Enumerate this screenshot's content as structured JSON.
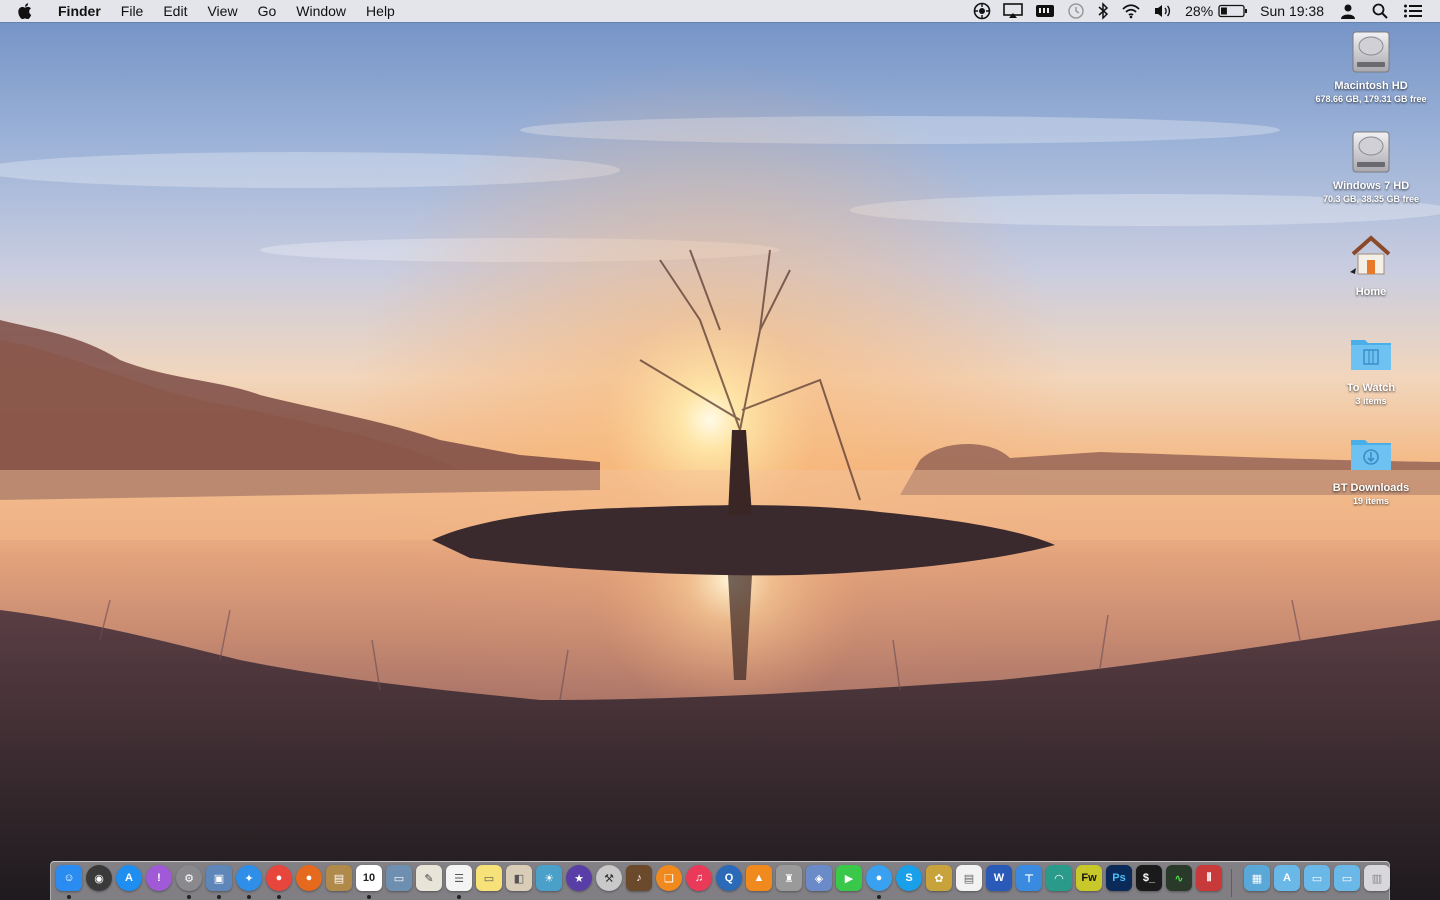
{
  "menubar": {
    "apple_icon": "apple-logo-icon",
    "app_name": "Finder",
    "menus": [
      "File",
      "Edit",
      "View",
      "Go",
      "Window",
      "Help"
    ],
    "status_icons": [
      "control-panel-icon",
      "airplay-icon",
      "screen-icon",
      "time-machine-icon",
      "bluetooth-icon",
      "wifi-icon",
      "volume-icon"
    ],
    "battery_percent": "28%",
    "battery_level": 0.28,
    "clock": "Sun 19:38",
    "user_icon": "user-icon",
    "search_icon": "spotlight-icon",
    "notifications_icon": "notification-center-icon"
  },
  "desktop": {
    "icons": [
      {
        "label": "Macintosh HD",
        "sub": "678.66 GB, 179.31 GB free",
        "icon": "hard-drive-icon"
      },
      {
        "label": "Windows 7 HD",
        "sub": "70.3 GB, 38.35 GB free",
        "icon": "hard-drive-icon"
      },
      {
        "label": "Home",
        "sub": "",
        "icon": "home-icon"
      },
      {
        "label": "To Watch",
        "sub": "3 items",
        "icon": "folder-icon"
      },
      {
        "label": "BT Downloads",
        "sub": "19 items",
        "icon": "folder-icon"
      }
    ]
  },
  "dock": {
    "items": [
      {
        "name": "finder",
        "glyph": "☺",
        "color": "#2a8cf0",
        "running": true
      },
      {
        "name": "dashboard",
        "glyph": "◉",
        "color": "#3a3a3a",
        "round": true,
        "running": false
      },
      {
        "name": "app-store",
        "glyph": "A",
        "color": "#1e8ff0",
        "round": true,
        "running": false
      },
      {
        "name": "itunes-alert",
        "glyph": "!",
        "color": "#a05ad8",
        "round": true,
        "running": false
      },
      {
        "name": "system-preferences",
        "glyph": "⚙",
        "color": "#8a8a8e",
        "round": true,
        "running": true
      },
      {
        "name": "preview",
        "glyph": "▣",
        "color": "#5f86b8",
        "running": true
      },
      {
        "name": "safari",
        "glyph": "✦",
        "color": "#2f8fe8",
        "round": true,
        "running": true
      },
      {
        "name": "chrome",
        "glyph": "●",
        "color": "#e8453c",
        "round": true,
        "running": true
      },
      {
        "name": "firefox",
        "glyph": "●",
        "color": "#e66a1e",
        "round": true,
        "running": false
      },
      {
        "name": "notefile",
        "glyph": "▤",
        "color": "#b08a4a",
        "running": false
      },
      {
        "name": "calendar",
        "glyph": "10",
        "color": "#ffffff",
        "textcolor": "#222",
        "running": true
      },
      {
        "name": "image-capture",
        "glyph": "▭",
        "color": "#6f8fb0",
        "running": false
      },
      {
        "name": "textedit",
        "glyph": "✎",
        "color": "#e8e4d8",
        "textcolor": "#444",
        "running": false
      },
      {
        "name": "reminders",
        "glyph": "☰",
        "color": "#f4f4f4",
        "textcolor": "#555",
        "running": true
      },
      {
        "name": "notes",
        "glyph": "▭",
        "color": "#f7e27a",
        "textcolor": "#555",
        "running": false
      },
      {
        "name": "contacts",
        "glyph": "◧",
        "color": "#d9cdb8",
        "textcolor": "#555",
        "running": false
      },
      {
        "name": "iphoto",
        "glyph": "☀",
        "color": "#4aa0c8",
        "running": false
      },
      {
        "name": "imovie",
        "glyph": "★",
        "color": "#5a3ea8",
        "round": true,
        "running": false
      },
      {
        "name": "disk-utility",
        "glyph": "⚒",
        "color": "#c9c9c9",
        "textcolor": "#333",
        "round": true,
        "running": false
      },
      {
        "name": "garageband",
        "glyph": "♪",
        "color": "#6a4a2a",
        "running": false
      },
      {
        "name": "ibooks",
        "glyph": "❑",
        "color": "#f08a1e",
        "round": true,
        "running": false
      },
      {
        "name": "itunes",
        "glyph": "♫",
        "color": "#ea3a5a",
        "round": true,
        "running": false
      },
      {
        "name": "quicktime",
        "glyph": "Q",
        "color": "#2a6ab8",
        "round": true,
        "running": false
      },
      {
        "name": "vlc",
        "glyph": "▲",
        "color": "#f08a1e",
        "running": false
      },
      {
        "name": "automator",
        "glyph": "♜",
        "color": "#9a9a9a",
        "running": false
      },
      {
        "name": "pacifist",
        "glyph": "◈",
        "color": "#6a8ac8",
        "running": false
      },
      {
        "name": "facetime",
        "glyph": "▶",
        "color": "#3ac84a",
        "running": false
      },
      {
        "name": "messages",
        "glyph": "●",
        "color": "#3aa0f0",
        "round": true,
        "running": true
      },
      {
        "name": "skype",
        "glyph": "S",
        "color": "#1aa0e8",
        "round": true,
        "running": false
      },
      {
        "name": "pineapple",
        "glyph": "✿",
        "color": "#c8a23a",
        "running": false
      },
      {
        "name": "text-doc",
        "glyph": "▤",
        "color": "#f2f2f2",
        "textcolor": "#666",
        "running": false
      },
      {
        "name": "word",
        "glyph": "W",
        "color": "#2a5ab8",
        "running": false
      },
      {
        "name": "keynote",
        "glyph": "⊤",
        "color": "#3a8ae0",
        "running": false
      },
      {
        "name": "wireless-diagnostics",
        "glyph": "◠",
        "color": "#2a9a8a",
        "running": false
      },
      {
        "name": "fireworks",
        "glyph": "Fw",
        "color": "#c8c82a",
        "textcolor": "#111",
        "running": false
      },
      {
        "name": "photoshop",
        "glyph": "Ps",
        "color": "#0a2a5a",
        "textcolor": "#4ac0f8",
        "running": false
      },
      {
        "name": "terminal",
        "glyph": "$_",
        "color": "#1a1a1a",
        "running": false
      },
      {
        "name": "activity-monitor",
        "glyph": "∿",
        "color": "#2a3a2a",
        "textcolor": "#4ae04a",
        "running": false
      },
      {
        "name": "parallels",
        "glyph": "⫴",
        "color": "#c83a3a",
        "running": false
      }
    ],
    "right_items": [
      {
        "name": "screenshots-stack",
        "glyph": "▦",
        "color": "#5aa8d8"
      },
      {
        "name": "applications-folder",
        "glyph": "A",
        "color": "#6ab8e8"
      },
      {
        "name": "documents-folder",
        "glyph": "▭",
        "color": "#6ab8e8"
      },
      {
        "name": "downloads-folder",
        "glyph": "▭",
        "color": "#6ab8e8"
      },
      {
        "name": "trash",
        "glyph": "▥",
        "color": "#d8d8dc",
        "textcolor": "#888"
      }
    ]
  }
}
